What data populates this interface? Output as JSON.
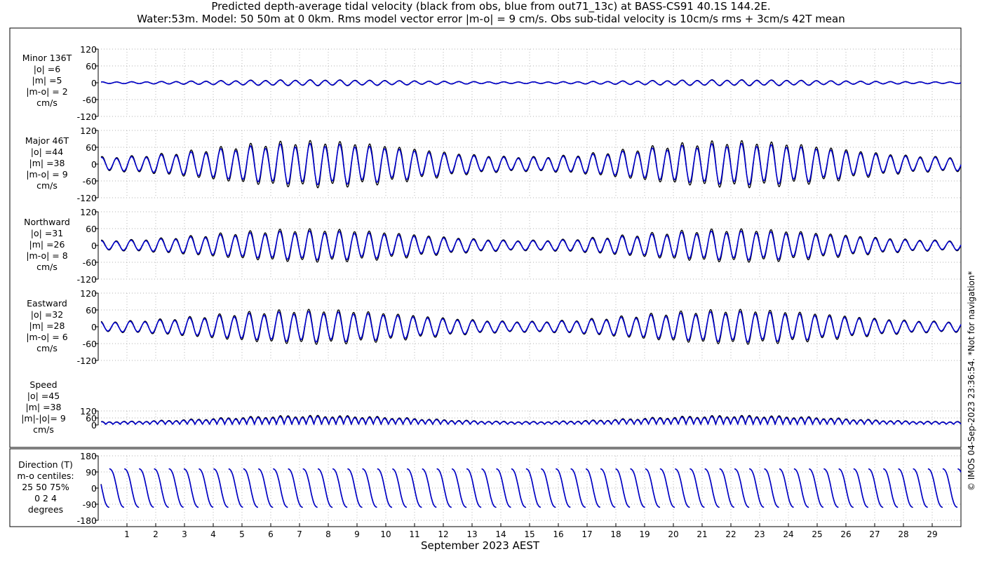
{
  "title_line1": "Predicted depth-average tidal velocity (black from obs, blue from out71_13c) at BASS-CS91 40.1S 144.2E.",
  "title_line2": "Water:53m. Model: 50 50m at 0 0km. Rms model vector error |m-o| = 9 cm/s. Obs sub-tidal velocity is 10cm/s rms + 3cm/s 42T mean",
  "credit": "© IMOS 04-Sep-2023 23:36:54. *Not for navigation*",
  "colors": {
    "obs": "#000000",
    "model": "#0000cc"
  },
  "chart_data": [
    {
      "type": "line",
      "id": "minor",
      "panel_label": [
        "Minor 136T",
        "|o| =6",
        "|m| =5",
        "|m-o| = 2",
        "cm/s"
      ],
      "ylim": [
        -120,
        120
      ],
      "yticks": [
        -120,
        -60,
        0,
        60,
        120
      ],
      "series": [
        {
          "role": "obs",
          "amplitude": 8
        },
        {
          "role": "model",
          "amplitude": 7
        }
      ]
    },
    {
      "type": "line",
      "id": "major",
      "panel_label": [
        "Major 46T",
        "|o| =44",
        "|m| =38",
        "|m-o| = 9",
        "cm/s"
      ],
      "ylim": [
        -120,
        120
      ],
      "yticks": [
        -120,
        -60,
        0,
        60,
        120
      ],
      "series": [
        {
          "role": "obs",
          "amplitude": 62
        },
        {
          "role": "model",
          "amplitude": 54
        }
      ]
    },
    {
      "type": "line",
      "id": "north",
      "panel_label": [
        "Northward",
        "|o| =31",
        "|m| =26",
        "|m-o| = 8",
        "cm/s"
      ],
      "ylim": [
        -120,
        120
      ],
      "yticks": [
        -120,
        -60,
        0,
        60,
        120
      ],
      "series": [
        {
          "role": "obs",
          "amplitude": 44
        },
        {
          "role": "model",
          "amplitude": 38
        }
      ]
    },
    {
      "type": "line",
      "id": "east",
      "panel_label": [
        "Eastward",
        "|o| =32",
        "|m| =28",
        "|m-o| = 6",
        "cm/s"
      ],
      "ylim": [
        -120,
        120
      ],
      "yticks": [
        -120,
        -60,
        0,
        60,
        120
      ],
      "series": [
        {
          "role": "obs",
          "amplitude": 46
        },
        {
          "role": "model",
          "amplitude": 40
        }
      ]
    },
    {
      "type": "line",
      "id": "speed",
      "panel_label": [
        "Speed",
        "|o| =45",
        "|m| =38",
        "|m|-|o|= 9",
        "cm/s"
      ],
      "ylim": [
        0,
        120
      ],
      "yticks": [
        0,
        60,
        120
      ],
      "series": [
        {
          "role": "obs",
          "amplitude": 62
        },
        {
          "role": "model",
          "amplitude": 54
        }
      ]
    },
    {
      "type": "line",
      "id": "direction",
      "panel_label": [
        "Direction (T)",
        "m-o centiles:",
        "25  50  75%",
        "0   2   4",
        "degrees"
      ],
      "ylim": [
        -180,
        180
      ],
      "yticks": [
        -180,
        -90,
        0,
        90,
        180
      ],
      "series": [
        {
          "role": "obs"
        },
        {
          "role": "model"
        }
      ]
    }
  ],
  "x_axis": {
    "label": "September 2023 AEST",
    "xlim": [
      0,
      30
    ],
    "ticks": [
      1,
      2,
      3,
      4,
      5,
      6,
      7,
      8,
      9,
      10,
      11,
      12,
      13,
      14,
      15,
      16,
      17,
      18,
      19,
      20,
      21,
      22,
      23,
      24,
      25,
      26,
      27,
      28,
      29
    ]
  },
  "tide_model": {
    "semidiurnal_period_hours": 12.42,
    "spring_neap_period_days": 14.77,
    "spring_days": [
      7.5,
      23.5
    ],
    "neap_days": [
      15.5
    ],
    "spring_factor": 1.25,
    "neap_factor": 0.4
  }
}
